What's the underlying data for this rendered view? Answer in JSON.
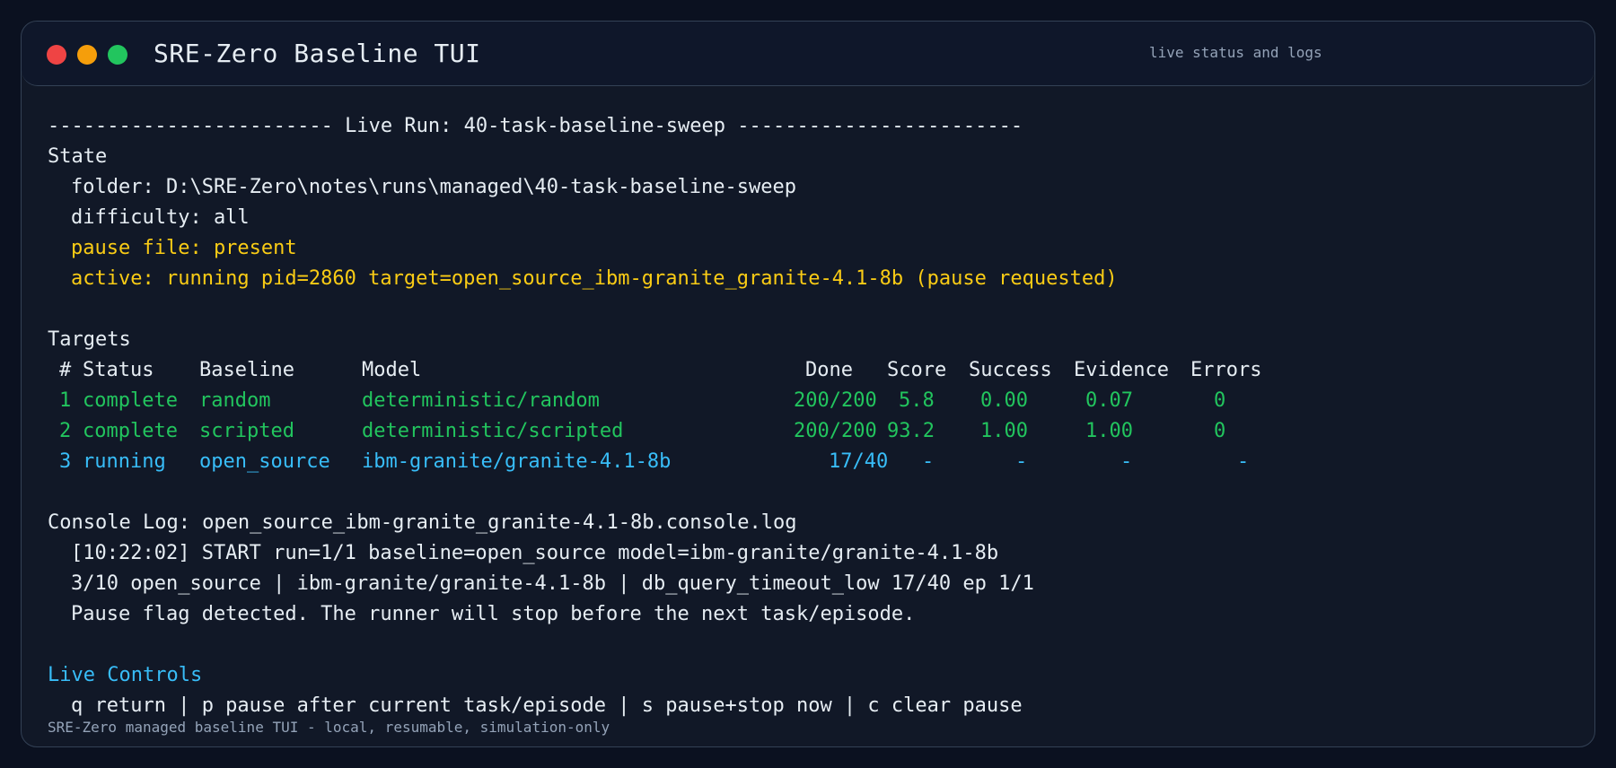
{
  "window": {
    "title": "SRE-Zero Baseline TUI",
    "subtitle": "live status and logs",
    "footer": "SRE-Zero managed baseline TUI - local, resumable, simulation-only"
  },
  "run": {
    "header": "------------------------ Live Run: 40-task-baseline-sweep ------------------------"
  },
  "state": {
    "heading": "State",
    "folder": "folder: D:\\SRE-Zero\\notes\\runs\\managed\\40-task-baseline-sweep",
    "difficulty": "difficulty: all",
    "pause_file": "pause file: present",
    "active": "active: running pid=2860 target=open_source_ibm-granite_granite-4.1-8b (pause requested)"
  },
  "targets": {
    "heading": "Targets",
    "columns": [
      "#",
      "Status",
      "Baseline",
      "Model",
      "Done",
      "Score",
      "Success",
      "Evidence",
      "Errors"
    ],
    "rows": [
      {
        "num": "1",
        "status": "complete",
        "baseline": "random",
        "model": "deterministic/random",
        "done": "200/200",
        "score": "5.8",
        "success": "0.00",
        "evidence": "0.07",
        "errors": "0"
      },
      {
        "num": "2",
        "status": "complete",
        "baseline": "scripted",
        "model": "deterministic/scripted",
        "done": "200/200",
        "score": "93.2",
        "success": "1.00",
        "evidence": "1.00",
        "errors": "0"
      },
      {
        "num": "3",
        "status": "running",
        "baseline": "open_source",
        "model": "ibm-granite/granite-4.1-8b",
        "done": "17/40",
        "score": "-",
        "success": "-",
        "evidence": "-",
        "errors": "-"
      }
    ]
  },
  "console": {
    "heading": "Console Log: open_source_ibm-granite_granite-4.1-8b.console.log",
    "lines": [
      "[10:22:02] START run=1/1 baseline=open_source model=ibm-granite/granite-4.1-8b",
      "3/10 open_source | ibm-granite/granite-4.1-8b | db_query_timeout_low 17/40 ep 1/1",
      "Pause flag detected. The runner will stop before the next task/episode."
    ]
  },
  "controls": {
    "heading": "Live Controls",
    "help": "q return | p pause after current task/episode | s pause+stop now | c clear pause"
  },
  "colors": {
    "background": "#0b1120",
    "panel": "#111827",
    "text": "#e6edf3",
    "warning": "#facc15",
    "complete": "#22c55e",
    "running": "#38bdf8",
    "muted": "#94a3b8"
  }
}
